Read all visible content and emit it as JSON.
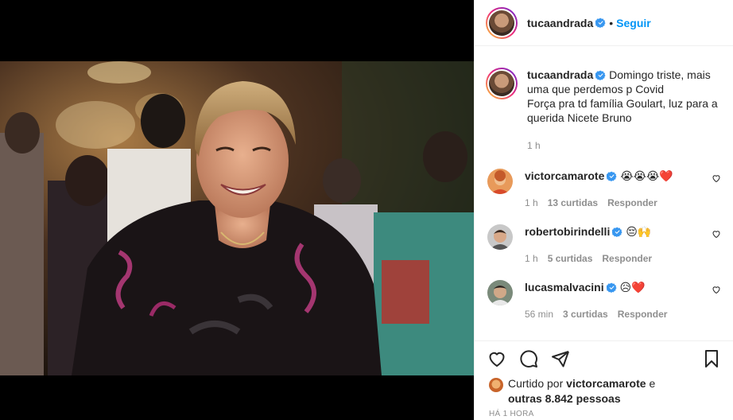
{
  "post": {
    "username": "tucaandrada",
    "follow_label": "Seguir",
    "separator": "•",
    "caption": "Domingo triste, mais uma que perdemos p Covid\nForça pra td família Goulart, luz para a querida Nicete Bruno",
    "caption_time": "1 h",
    "verified_icon": "verified-badge-icon",
    "colors": {
      "link": "#0095f6",
      "verified": "#3897f0",
      "text": "#262626",
      "muted": "#8e8e8e"
    }
  },
  "comments": [
    {
      "username": "victorcamarote",
      "emoji": "😭😭😭❤️",
      "time": "1 h",
      "likes": "13 curtidas",
      "reply": "Responder"
    },
    {
      "username": "robertobirindelli",
      "emoji": "😔🙌",
      "time": "1 h",
      "likes": "5 curtidas",
      "reply": "Responder"
    },
    {
      "username": "lucasmalvacini",
      "emoji": "😥❤️",
      "time": "56 min",
      "likes": "3 curtidas",
      "reply": "Responder"
    }
  ],
  "actions": {
    "liked_prefix": "Curtido por",
    "liked_user": "victorcamarote",
    "liked_mid": "e",
    "liked_others": "outras 8.842 pessoas",
    "timestamp": "HÁ 1 HORA",
    "icons": [
      "heart-icon",
      "comment-icon",
      "share-icon",
      "bookmark-icon"
    ]
  }
}
